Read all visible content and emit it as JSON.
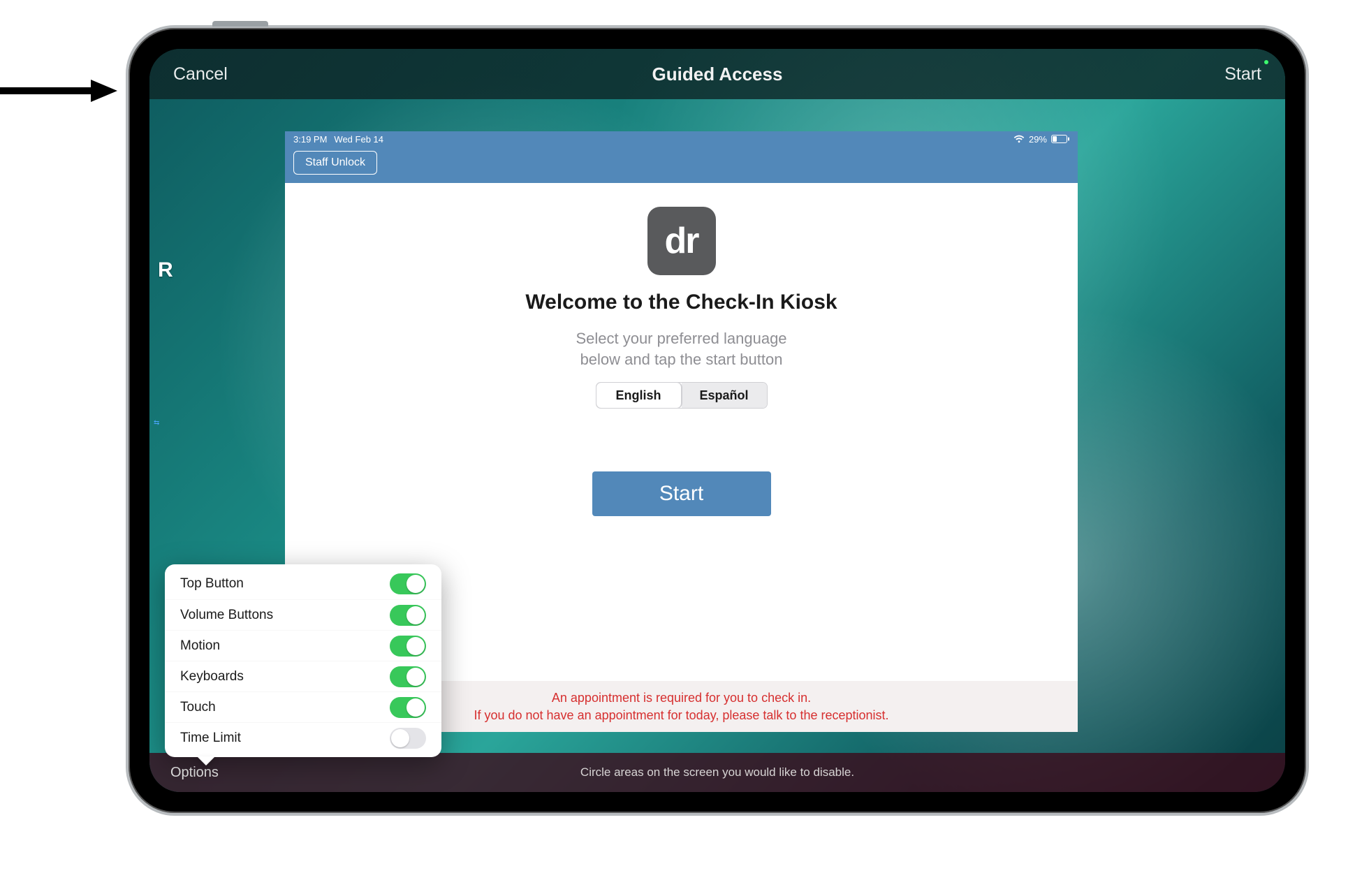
{
  "guided_access": {
    "cancel": "Cancel",
    "title": "Guided Access",
    "start": "Start",
    "options_label": "Options",
    "hint": "Circle areas on the screen you would like to disable."
  },
  "background": {
    "visible_letter": "R",
    "tiny_glyph": "⇆"
  },
  "kiosk": {
    "status_time": "3:19 PM",
    "status_date": "Wed Feb 14",
    "battery_text": "29%",
    "staff_unlock": "Staff Unlock",
    "logo_text": "dr",
    "welcome": "Welcome to the Check-In Kiosk",
    "subtitle_line1": "Select your preferred language",
    "subtitle_line2": "below and tap the start button",
    "lang": {
      "english": "English",
      "spanish": "Español"
    },
    "start": "Start",
    "footer_line1": "An appointment is required for you to check in.",
    "footer_line2": "If you do not have an appointment for today, please talk to the receptionist."
  },
  "options": [
    {
      "label": "Top Button",
      "on": true
    },
    {
      "label": "Volume Buttons",
      "on": true
    },
    {
      "label": "Motion",
      "on": true
    },
    {
      "label": "Keyboards",
      "on": true
    },
    {
      "label": "Touch",
      "on": true
    },
    {
      "label": "Time Limit",
      "on": false
    }
  ]
}
